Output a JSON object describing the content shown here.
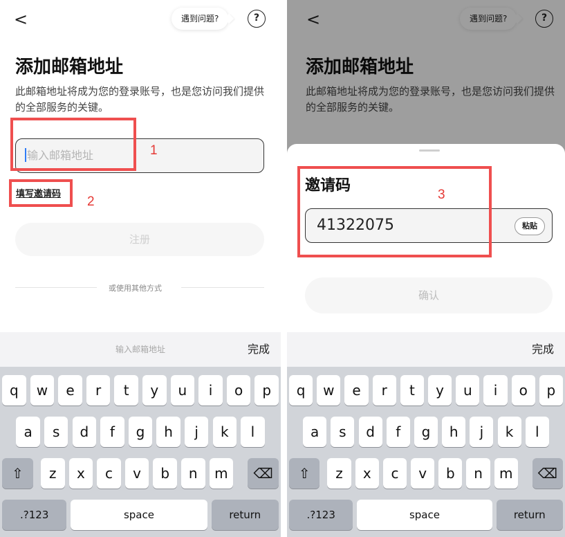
{
  "left": {
    "back": "<",
    "help_text": "遇到问题?",
    "help_icon": "?",
    "title": "添加邮箱地址",
    "description": "此邮箱地址将成为您的登录账号，也是您访问我们提供的全部服务的关键。",
    "email_placeholder": "输入邮箱地址",
    "invite_link": "填写邀请码",
    "register_button": "注册",
    "other_methods": "或使用其他方式",
    "keyboard_hint": "输入邮箱地址",
    "keyboard_done": "完成",
    "annotations": [
      "1",
      "2"
    ]
  },
  "right": {
    "back": "<",
    "help_text": "遇到问题?",
    "help_icon": "?",
    "title": "添加邮箱地址",
    "description": "此邮箱地址将成为您的登录账号，也是您访问我们提供的全部服务的关键。",
    "sheet_title": "邀请码",
    "invite_code": "41322075",
    "paste_button": "粘贴",
    "confirm_button": "确认",
    "keyboard_done": "完成",
    "annotation": "3"
  },
  "keyboard": {
    "row1": [
      "q",
      "w",
      "e",
      "r",
      "t",
      "y",
      "u",
      "i",
      "o",
      "p"
    ],
    "row2": [
      "a",
      "s",
      "d",
      "f",
      "g",
      "h",
      "j",
      "k",
      "l"
    ],
    "row3": [
      "z",
      "x",
      "c",
      "v",
      "b",
      "n",
      "m"
    ],
    "shift_icon": "⇧",
    "backspace_icon": "⌫",
    "symbols": ".?123",
    "space": "space",
    "return": "return"
  },
  "colors": {
    "annotation": "#ef4f4f",
    "caret": "#2f7cf6",
    "keyboard_bg": "#d1d4d9"
  }
}
